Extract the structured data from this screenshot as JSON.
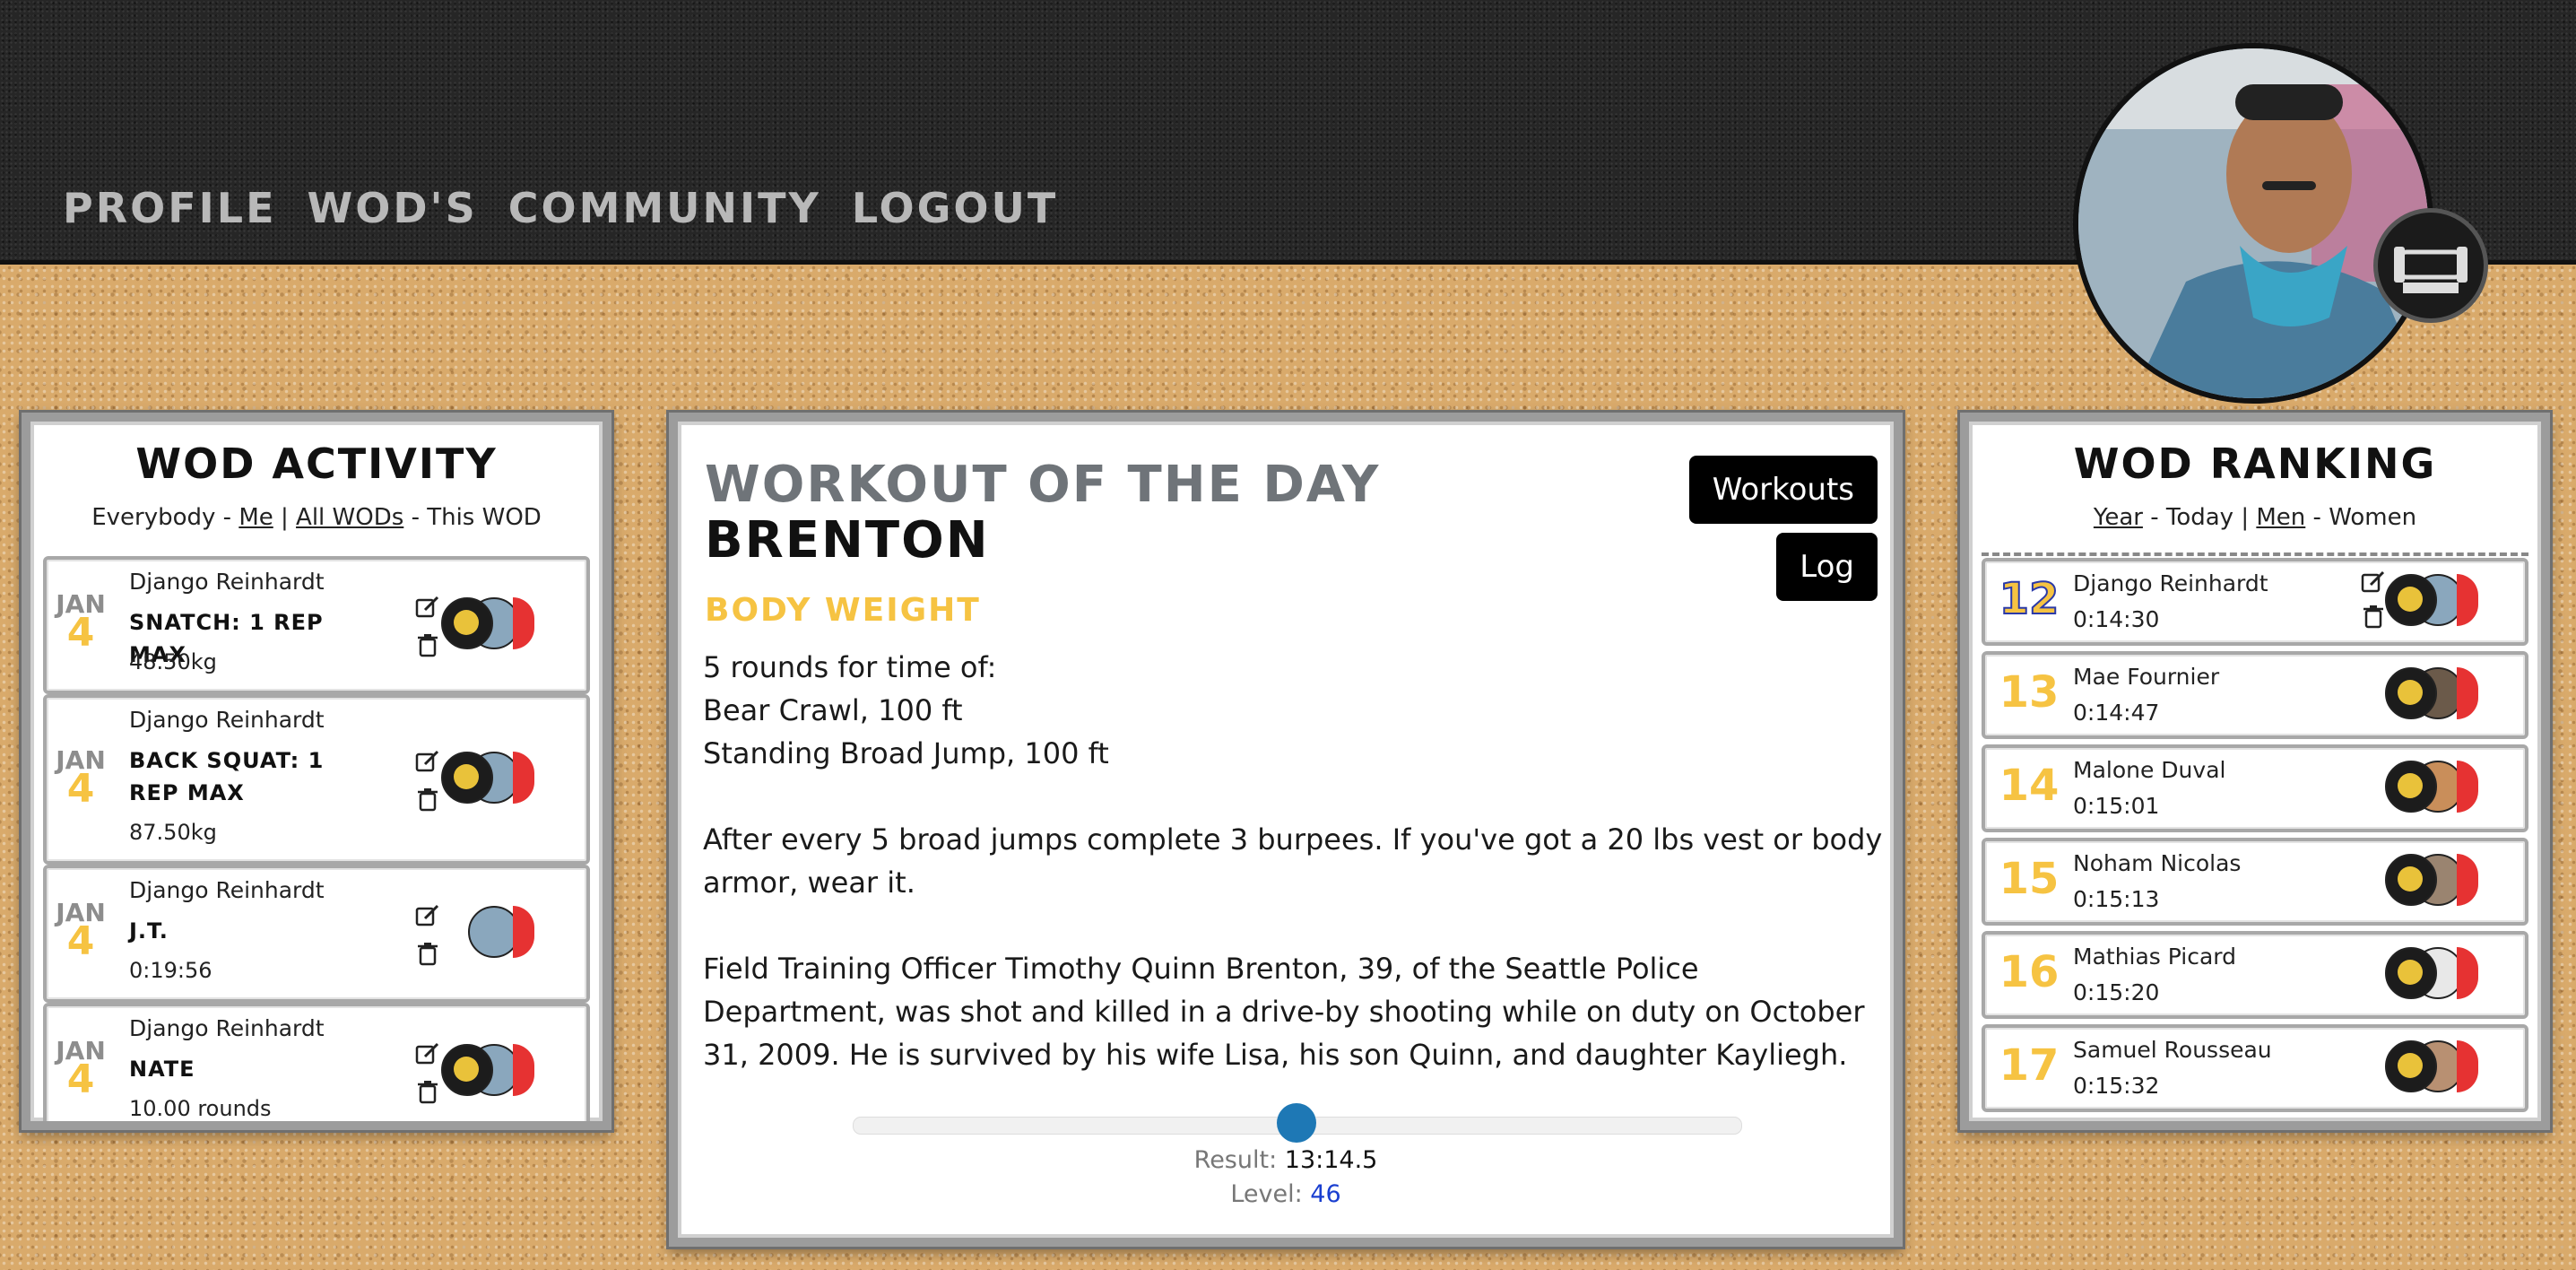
{
  "nav": {
    "items": [
      "PROFILE",
      "WOD'S",
      "COMMUNITY",
      "LOGOUT"
    ]
  },
  "activity": {
    "title": "WOD ACTIVITY",
    "filters": [
      "Everybody",
      "Me",
      "All WODs",
      "This WOD"
    ],
    "sep_dash": "-",
    "sep_bar": "|",
    "cards": [
      {
        "month": "JAN",
        "day": "4",
        "name": "Django Reinhardt",
        "title": "SNATCH: 1 REP MAX",
        "value": "48.50kg"
      },
      {
        "month": "JAN",
        "day": "4",
        "name": "Django Reinhardt",
        "title": "BACK SQUAT: 1 REP MAX",
        "value": "87.50kg"
      },
      {
        "month": "JAN",
        "day": "4",
        "name": "Django Reinhardt",
        "title": "J.T.",
        "value": "0:19:56"
      },
      {
        "month": "JAN",
        "day": "4",
        "name": "Django Reinhardt",
        "title": "NATE",
        "value": "10.00 rounds"
      }
    ]
  },
  "wod": {
    "kicker": "WORKOUT OF THE DAY",
    "name": "BRENTON",
    "type": "BODY WEIGHT",
    "workouts_button": "Workouts",
    "log_button": "Log",
    "lines": [
      "5 rounds for time of:",
      "Bear Crawl, 100 ft",
      "Standing Broad Jump, 100 ft"
    ],
    "note": "After every 5 broad jumps complete 3 burpees. If you've got a 20 lbs vest or body armor, wear it.",
    "story": "Field Training Officer Timothy Quinn Brenton, 39, of the Seattle Police Department, was shot and killed in a drive-by shooting while on duty on October 31, 2009. He is survived by his wife Lisa, his son Quinn, and daughter Kayliegh.",
    "result_label": "Result:",
    "result_value": "13:14.5",
    "level_label": "Level:",
    "level_value": "46",
    "slider_fraction": 0.5
  },
  "ranking": {
    "title": "WOD RANKING",
    "filters": [
      "Year",
      "Today",
      "Men",
      "Women"
    ],
    "rows": [
      {
        "rank": "12",
        "name": "Django Reinhardt",
        "time": "0:14:30",
        "editable": true
      },
      {
        "rank": "13",
        "name": "Mae Fournier",
        "time": "0:14:47",
        "editable": false
      },
      {
        "rank": "14",
        "name": "Malone Duval",
        "time": "0:15:01",
        "editable": false
      },
      {
        "rank": "15",
        "name": "Noham Nicolas",
        "time": "0:15:13",
        "editable": false
      },
      {
        "rank": "16",
        "name": "Mathias Picard",
        "time": "0:15:20",
        "editable": false
      },
      {
        "rank": "17",
        "name": "Samuel Rousseau",
        "time": "0:15:32",
        "editable": false
      }
    ]
  },
  "colors": {
    "accent_yellow": "#f6c342",
    "level_blue": "#1a3fd0",
    "slider_blue": "#1e78b5",
    "flag_red": "#e63232"
  },
  "icons": [
    "edit-icon",
    "trash-icon",
    "hero-community-badge-icon"
  ]
}
